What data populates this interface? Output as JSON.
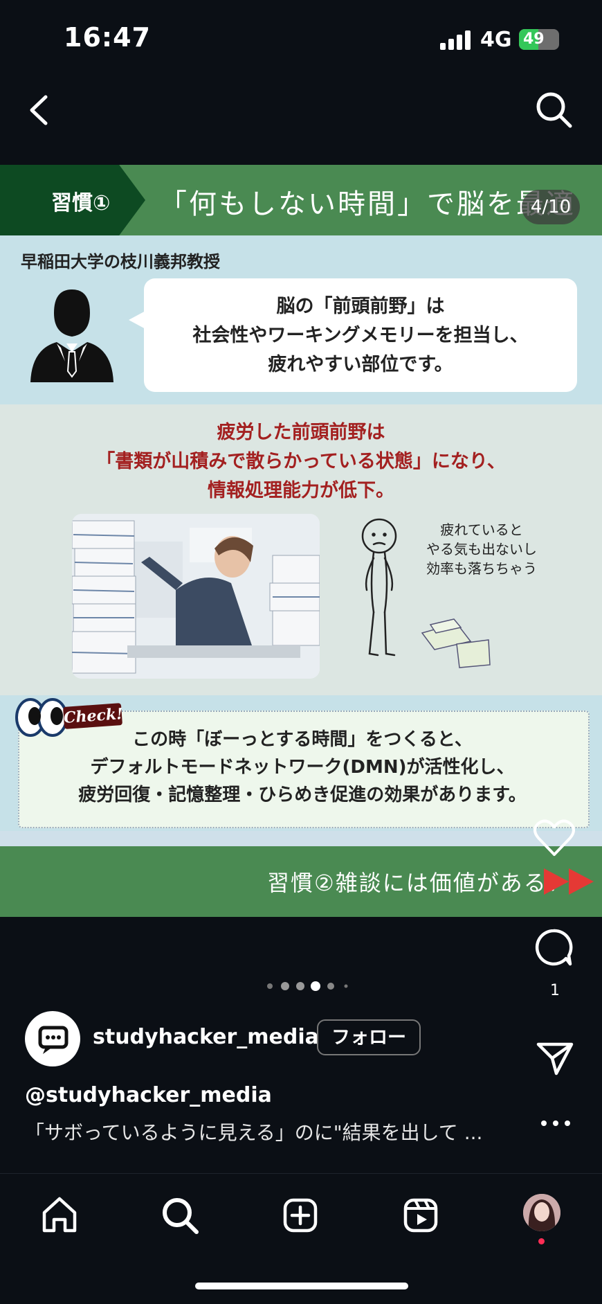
{
  "status_bar": {
    "time": "16:47",
    "network": "4G",
    "battery": "49",
    "battery_level": 0.49
  },
  "post": {
    "banner_tag": "習慣①",
    "banner_title": "「何もしない時間」で脳を最適",
    "slide_counter": "4/10",
    "professor_label": "早稲田大学の枝川義邦教授",
    "bubble_lines": [
      "脳の「前頭前野」は",
      "社会性やワーキングメモリーを担当し、",
      "疲れやすい部位です。"
    ],
    "red_lines": [
      "疲労した前頭前野は",
      "「書類が山積みで散らかっている状態」になり、",
      "情報処理能力が低下。"
    ],
    "sketch_lines": [
      "疲れていると",
      "やる気も出ないし",
      "効率も落ちちゃう"
    ],
    "check_label": "Check!",
    "check_lines": [
      "この時「ぼーっとする時間」をつくると、",
      "デフォルトモードネットワーク(DMN)が活性化し、",
      "疲労回復・記憶整理・ひらめき促進の効果があります。"
    ],
    "next_text": "習慣②雑談には価値がある！"
  },
  "actions": {
    "comment_count": "1"
  },
  "profile": {
    "username": "studyhacker_media",
    "follow_label": "フォロー"
  },
  "caption": {
    "user": "@studyhacker_media",
    "text": "「サボっているように見える」のに\"結果を出して ..."
  },
  "colors": {
    "banner_green": "#4a8a52",
    "tag_dark_green": "#0d4a22",
    "red_text": "#a32020",
    "arrow_red": "#e53935"
  },
  "icons": [
    "back-icon",
    "search-icon",
    "heart-icon",
    "comment-icon",
    "send-icon",
    "more-icon",
    "home-icon",
    "reels-icon",
    "create-icon"
  ]
}
